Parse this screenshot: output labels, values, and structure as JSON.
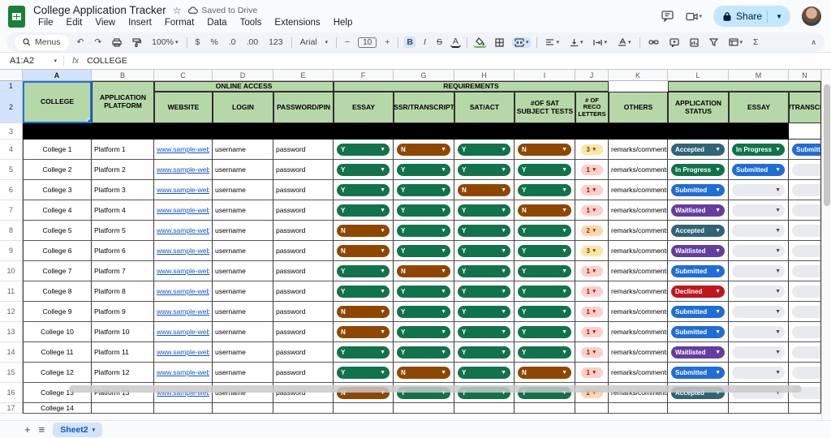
{
  "titlebar": {
    "title": "College Application Tracker",
    "star": "☆",
    "saved": "Saved to Drive",
    "menus": [
      "File",
      "Edit",
      "View",
      "Insert",
      "Format",
      "Data",
      "Tools",
      "Extensions",
      "Help"
    ],
    "share": "Share"
  },
  "toolbar": {
    "menus_label": "Menus",
    "undo": "↶",
    "redo": "↷",
    "zoom": "100%",
    "dollar": "$",
    "percent": "%",
    "dec0": ".0",
    "dec00": ".00",
    "n123": "123",
    "font": "Arial",
    "minus": "−",
    "size": "10",
    "plus": "+",
    "bold": "B",
    "italic": "I",
    "strike": "S",
    "textcolor": "A",
    "sigma": "Σ",
    "collapse": "∧",
    "caret": "▾"
  },
  "formula_bar": {
    "range": "A1:A2",
    "fx": "fx",
    "value": "COLLEGE"
  },
  "grid": {
    "column_letters": [
      "A",
      "B",
      "C",
      "D",
      "E",
      "F",
      "G",
      "H",
      "I",
      "J",
      "K",
      "L",
      "M",
      "N"
    ],
    "row1_numbers": [
      "1",
      "2"
    ],
    "black_row_number": "3",
    "headers": {
      "college": "COLLEGE",
      "platform": "APPLICATION PLATFORM",
      "online_access": "ONLINE ACCESS",
      "website": "WEBSITE",
      "login": "LOGIN",
      "password": "PASSWORD/PIN",
      "requirements": "REQUIREMENTS",
      "essay": "ESSAY",
      "ssr": "SSR/TRANSCRIPT",
      "sat": "SAT/ACT",
      "sat_subject": "#OF SAT SUBJECT TESTS",
      "reco": "# OF RECO LETTERS",
      "others": "OTHERS",
      "app_status": "APPLICATION STATUS",
      "essay_status": "ESSAY",
      "ssr_status": "SSR/TRANSCRIPT"
    },
    "rows": [
      {
        "row": "4",
        "college": "College 1",
        "platform": "Platform 1",
        "website": "www.sample-websit",
        "login": "username",
        "password": "password",
        "essay": "Y",
        "ssr": "N",
        "sat": "Y",
        "sat_subject": "N",
        "reco": "3",
        "others": "remarks/comments",
        "status": "Accepted",
        "essay_status": "In Progress",
        "ssr_status": "Submitted"
      },
      {
        "row": "5",
        "college": "College 2",
        "platform": "Platform 2",
        "website": "www.sample-websit",
        "login": "username",
        "password": "password",
        "essay": "Y",
        "ssr": "Y",
        "sat": "Y",
        "sat_subject": "Y",
        "reco": "1",
        "others": "remarks/comments",
        "status": "In Progress",
        "essay_status": "Submitted",
        "ssr_status": ""
      },
      {
        "row": "6",
        "college": "College 3",
        "platform": "Platform 3",
        "website": "www.sample-websit",
        "login": "username",
        "password": "password",
        "essay": "Y",
        "ssr": "Y",
        "sat": "N",
        "sat_subject": "Y",
        "reco": "1",
        "others": "remarks/comments",
        "status": "Submitted",
        "essay_status": "",
        "ssr_status": ""
      },
      {
        "row": "7",
        "college": "College 4",
        "platform": "Platform 4",
        "website": "www.sample-websit",
        "login": "username",
        "password": "password",
        "essay": "Y",
        "ssr": "Y",
        "sat": "Y",
        "sat_subject": "N",
        "reco": "1",
        "others": "remarks/comments",
        "status": "Waitlisted",
        "essay_status": "",
        "ssr_status": ""
      },
      {
        "row": "8",
        "college": "College 5",
        "platform": "Platform 5",
        "website": "www.sample-websit",
        "login": "username",
        "password": "password",
        "essay": "N",
        "ssr": "Y",
        "sat": "Y",
        "sat_subject": "Y",
        "reco": "2",
        "others": "remarks/comments",
        "status": "Accepted",
        "essay_status": "",
        "ssr_status": ""
      },
      {
        "row": "9",
        "college": "College 6",
        "platform": "Platform 6",
        "website": "www.sample-websit",
        "login": "username",
        "password": "password",
        "essay": "N",
        "ssr": "Y",
        "sat": "Y",
        "sat_subject": "Y",
        "reco": "3",
        "others": "remarks/comments",
        "status": "Waitlisted",
        "essay_status": "",
        "ssr_status": ""
      },
      {
        "row": "10",
        "college": "College 7",
        "platform": "Platform 7",
        "website": "www.sample-websit",
        "login": "username",
        "password": "password",
        "essay": "Y",
        "ssr": "N",
        "sat": "Y",
        "sat_subject": "Y",
        "reco": "1",
        "others": "remarks/comments",
        "status": "Submitted",
        "essay_status": "",
        "ssr_status": ""
      },
      {
        "row": "11",
        "college": "College 8",
        "platform": "Platform 8",
        "website": "www.sample-websit",
        "login": "username",
        "password": "password",
        "essay": "Y",
        "ssr": "Y",
        "sat": "Y",
        "sat_subject": "Y",
        "reco": "1",
        "others": "remarks/comments",
        "status": "Declined",
        "essay_status": "",
        "ssr_status": ""
      },
      {
        "row": "12",
        "college": "College 9",
        "platform": "Platform 9",
        "website": "www.sample-websit",
        "login": "username",
        "password": "password",
        "essay": "N",
        "ssr": "Y",
        "sat": "Y",
        "sat_subject": "Y",
        "reco": "1",
        "others": "remarks/comments",
        "status": "Submitted",
        "essay_status": "",
        "ssr_status": ""
      },
      {
        "row": "13",
        "college": "College 10",
        "platform": "Platform 10",
        "website": "www.sample-websit",
        "login": "username",
        "password": "password",
        "essay": "N",
        "ssr": "Y",
        "sat": "Y",
        "sat_subject": "Y",
        "reco": "1",
        "others": "remarks/comments",
        "status": "Submitted",
        "essay_status": "",
        "ssr_status": ""
      },
      {
        "row": "14",
        "college": "College 11",
        "platform": "Platform 11",
        "website": "www.sample-websit",
        "login": "username",
        "password": "password",
        "essay": "Y",
        "ssr": "Y",
        "sat": "Y",
        "sat_subject": "Y",
        "reco": "1",
        "others": "remarks/comments",
        "status": "Waitlisted",
        "essay_status": "",
        "ssr_status": ""
      },
      {
        "row": "15",
        "college": "College 12",
        "platform": "Platform 12",
        "website": "www.sample-websit",
        "login": "username",
        "password": "password",
        "essay": "Y",
        "ssr": "N",
        "sat": "Y",
        "sat_subject": "N",
        "reco": "1",
        "others": "remarks/comments",
        "status": "Submitted",
        "essay_status": "",
        "ssr_status": ""
      },
      {
        "row": "16",
        "college": "College 13",
        "platform": "Platform 13",
        "website": "www.sample-websit",
        "login": "username",
        "password": "password",
        "essay": "N",
        "ssr": "Y",
        "sat": "Y",
        "sat_subject": "Y",
        "reco": "2",
        "others": "remarks/comments",
        "status": "Accepted",
        "essay_status": "",
        "ssr_status": ""
      }
    ],
    "partial_row": {
      "row": "17",
      "college": "College 14"
    }
  },
  "colors": {
    "header_green": "#b6d7a8",
    "selection_blue": "#1a73e8",
    "pill": {
      "Y": "#11734b",
      "N": "#8f4700",
      "Accepted": "#2f6577",
      "In Progress": "#11734b",
      "Submitted": "#1f6dd6",
      "Waitlisted": "#643d9e",
      "Declined": "#c0161c",
      "empty": "#e8eaed"
    },
    "reco": {
      "1": {
        "bg": "#ffcfc9",
        "fg": "#b10202"
      },
      "2": {
        "bg": "#ffd5b0",
        "fg": "#8a3a00"
      },
      "3": {
        "bg": "#ffe5a0",
        "fg": "#5b4a1f"
      }
    }
  },
  "sheet_bar": {
    "add": "+",
    "all_sheets": "≡",
    "tab": "Sheet2"
  }
}
